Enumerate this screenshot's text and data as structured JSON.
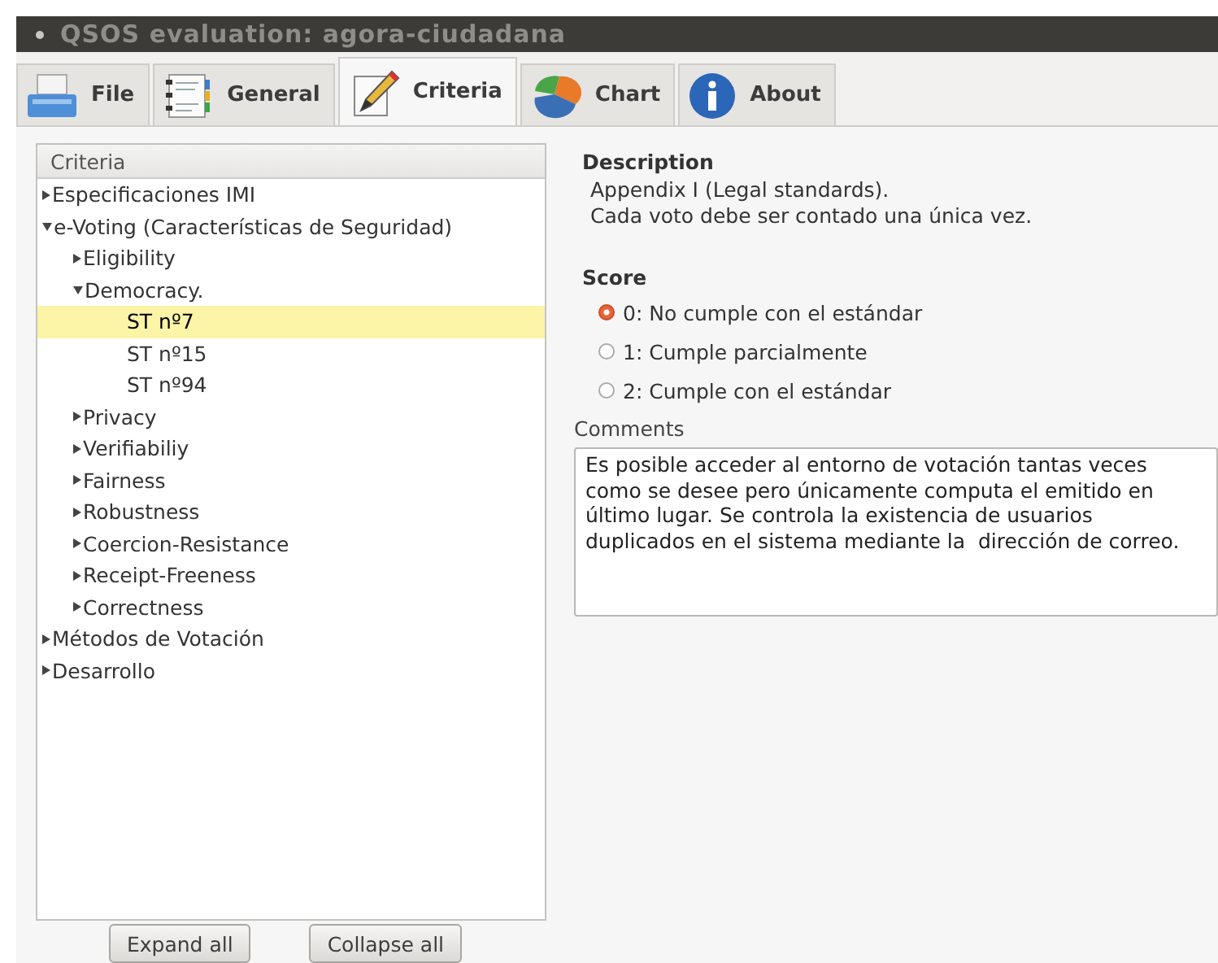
{
  "window": {
    "title": "QSOS evaluation: agora-ciudadana"
  },
  "tabs": [
    {
      "label": "File",
      "kind": "printer",
      "selected": false
    },
    {
      "label": "General",
      "kind": "notebook",
      "selected": false
    },
    {
      "label": "Criteria",
      "kind": "pencil",
      "selected": true
    },
    {
      "label": "Chart",
      "kind": "pie",
      "selected": false
    },
    {
      "label": "About",
      "kind": "info",
      "selected": false
    }
  ],
  "tree": {
    "header": "Criteria",
    "items": [
      {
        "label": "Especificaciones IMI",
        "expanded": false,
        "selected": false
      },
      {
        "label": "e-Voting (Características de Seguridad)",
        "expanded": true,
        "selected": false,
        "children": [
          {
            "label": "Eligibility",
            "expanded": false,
            "selected": false
          },
          {
            "label": "Democracy.",
            "expanded": true,
            "selected": false,
            "children": [
              {
                "label": "ST nº7",
                "selected": true
              },
              {
                "label": "ST nº15",
                "selected": false
              },
              {
                "label": "ST nº94",
                "selected": false
              }
            ]
          },
          {
            "label": "Privacy",
            "expanded": false,
            "selected": false
          },
          {
            "label": "Verifiabiliy",
            "expanded": false,
            "selected": false
          },
          {
            "label": "Fairness",
            "expanded": false,
            "selected": false
          },
          {
            "label": "Robustness",
            "expanded": false,
            "selected": false
          },
          {
            "label": "Coercion-Resistance",
            "expanded": false,
            "selected": false
          },
          {
            "label": "Receipt-Freeness",
            "expanded": false,
            "selected": false
          },
          {
            "label": "Correctness",
            "expanded": false,
            "selected": false
          }
        ]
      },
      {
        "label": "Métodos de Votación",
        "expanded": false,
        "selected": false
      },
      {
        "label": "Desarrollo",
        "expanded": false,
        "selected": false
      }
    ]
  },
  "tree_buttons": [
    "Expand all",
    "Collapse all"
  ],
  "description": {
    "heading": "Description",
    "lines": [
      "Appendix I (Legal standards).",
      "Cada voto debe ser contado una única vez."
    ]
  },
  "score": {
    "heading": "Score",
    "options": [
      {
        "label": "0: No cumple con el estándar",
        "selected": true
      },
      {
        "label": "1: Cumple parcialmente",
        "selected": false
      },
      {
        "label": "2: Cumple con el estándar",
        "selected": false
      }
    ]
  },
  "comments": {
    "label": "Comments",
    "value": "Es posible acceder al entorno de votación tantas veces como se desee pero únicamente computa el emitido en último lugar. Se controla la existencia de usuarios duplicados en el sistema mediante la  dirección de correo."
  }
}
